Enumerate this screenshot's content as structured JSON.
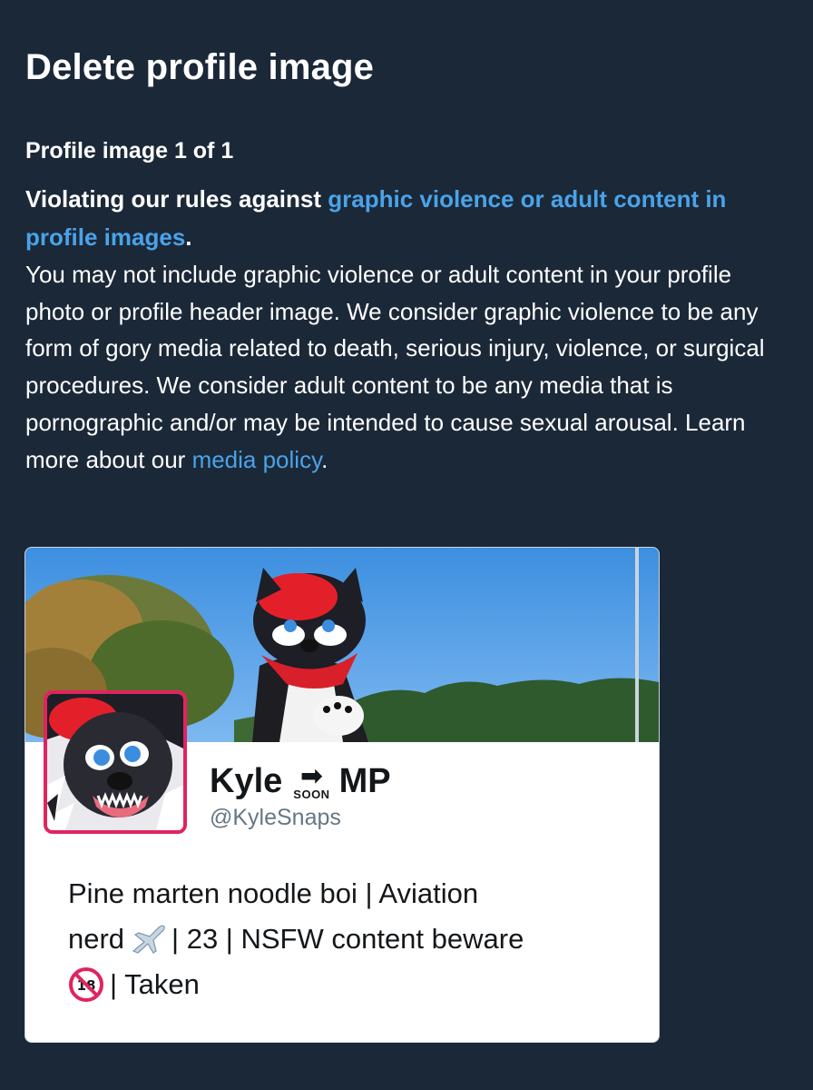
{
  "dialog": {
    "title": "Delete profile image",
    "counter": "Profile image 1 of 1",
    "rule_prefix": "Violating our rules against ",
    "rule_link": "graphic violence or adult content in profile images",
    "rule_suffix": ".",
    "body": "You may not include graphic violence or adult content in your profile photo or profile header image. We consider graphic violence to be any form of gory media related to death, serious injury, violence, or surgical procedures. We consider adult content to be any media that is pornographic and/or may be intended to cause sexual arousal. Learn more about our ",
    "policy_link": "media policy",
    "body_end": "."
  },
  "profile": {
    "name_start": "Kyle",
    "name_soon": "SOON",
    "name_end": "MP",
    "handle": "@KyleSnaps",
    "bio_line1": "Pine marten noodle boi | Aviation",
    "bio_line2_a": "nerd",
    "bio_line2_b": "| 23 | NSFW content beware",
    "bio_line3": "| Taken",
    "icons": [
      "soon-arrow-icon",
      "airplane-icon",
      "no-under-18-icon"
    ]
  },
  "colors": {
    "background": "#1b2838",
    "link": "#4aa3e8",
    "avatar_border": "#e0245e",
    "card": "#ffffff"
  }
}
